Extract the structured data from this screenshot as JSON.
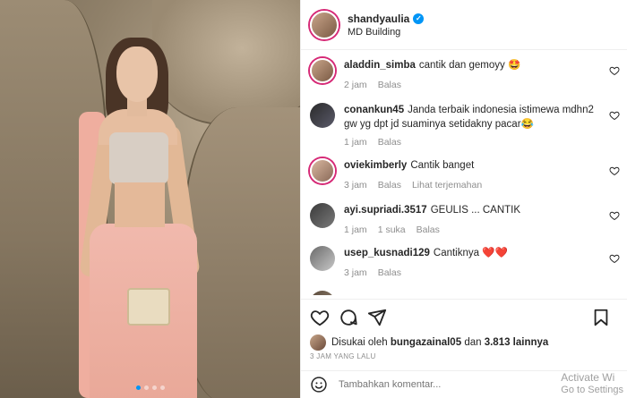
{
  "post": {
    "username": "shandyaulia",
    "location": "MD Building",
    "carousel_count": 4,
    "carousel_active": 0
  },
  "comments": [
    {
      "username": "aladdin_simba",
      "text": "cantik dan gemoyy 🤩",
      "time": "2 jam",
      "reply": "Balas",
      "likes": "",
      "translate": ""
    },
    {
      "username": "conankun45",
      "text": "Janda terbaik indonesia istimewa mdhn2 gw yg dpt jd suaminya setidakny pacar😂",
      "time": "1 jam",
      "reply": "Balas",
      "likes": "",
      "translate": ""
    },
    {
      "username": "oviekimberly",
      "text": "Cantik banget",
      "time": "3 jam",
      "reply": "Balas",
      "likes": "",
      "translate": "Lihat terjemahan"
    },
    {
      "username": "ayi.supriadi.3517",
      "text": "GEULIS ... CANTIK",
      "time": "1 jam",
      "reply": "Balas",
      "likes": "1 suka",
      "translate": ""
    },
    {
      "username": "usep_kusnadi129",
      "text": "Cantiknya ❤️❤️",
      "time": "3 jam",
      "reply": "Balas",
      "likes": "",
      "translate": ""
    }
  ],
  "likes": {
    "prefix": "Disukai oleh",
    "user": "bungazainal05",
    "joiner": "dan",
    "count": "3.813 lainnya"
  },
  "time_ago": "3 JAM YANG LALU",
  "add_comment": {
    "placeholder": "Tambahkan komentar..."
  },
  "watermark": {
    "line1": "Activate Wi",
    "line2": "Go to Settings"
  },
  "icons": {
    "like": "heart-icon",
    "comment": "comment-icon",
    "share": "paper-plane-icon",
    "save": "bookmark-icon",
    "emoji": "emoji-icon",
    "verified": "verified-badge-icon"
  },
  "colors": {
    "accent": "#0095f6",
    "muted": "#8e8e8e",
    "text": "#262626"
  }
}
